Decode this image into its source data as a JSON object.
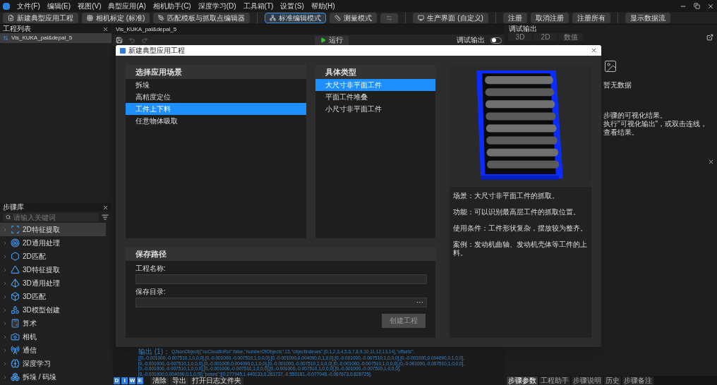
{
  "menu": [
    "文件(F)",
    "编辑(E)",
    "视图(V)",
    "典型应用(A)",
    "相机助手(C)",
    "深度学习(D)",
    "工具箱(T)",
    "设置(S)",
    "帮助(H)"
  ],
  "toolbar_groups": [
    [
      {
        "kind": "new",
        "label": "新建典型应用工程"
      },
      {
        "kind": "calib",
        "label": "相机标定 (标准)"
      },
      {
        "kind": "match",
        "label": "匹配模板与抓取点编辑器"
      }
    ],
    [
      {
        "kind": "mode",
        "label": "标准编辑模式",
        "selected": true
      },
      {
        "kind": "measure",
        "label": "测量模式",
        "selected": false
      },
      {
        "kind": "nav"
      }
    ],
    [
      {
        "kind": "production",
        "label": "生产界面 (自定义)"
      }
    ],
    [
      {
        "kind": "plain",
        "label": "注册"
      },
      {
        "kind": "plain",
        "label": "取消注册"
      },
      {
        "kind": "plain",
        "label": "注册所有"
      }
    ],
    [
      {
        "kind": "plain",
        "label": "显示数据流"
      }
    ]
  ],
  "project_list": {
    "title": "工程列表",
    "items": [
      {
        "label": "Vis_KUKA_pal&depal_5",
        "selected": true
      }
    ]
  },
  "step_library": {
    "title": "步骤库",
    "search_placeholder": "请输入关键词",
    "items": [
      {
        "kind": "scan",
        "label": "2D特征提取",
        "selected": true,
        "expanded": false
      },
      {
        "kind": "target",
        "label": "2D通用处理",
        "selected": false,
        "expanded": false
      },
      {
        "kind": "hexagon",
        "label": "2D匹配",
        "selected": false,
        "expanded": false
      },
      {
        "kind": "triangle",
        "label": "3D特征提取",
        "selected": false,
        "expanded": false
      },
      {
        "kind": "pyramid",
        "label": "3D通用处理",
        "selected": false,
        "expanded": false
      },
      {
        "kind": "box",
        "label": "3D匹配",
        "selected": false,
        "expanded": false
      },
      {
        "kind": "shapes",
        "label": "3D模型创建",
        "selected": false,
        "expanded": false
      },
      {
        "kind": "calculator",
        "label": "算术",
        "selected": false,
        "expanded": false
      },
      {
        "kind": "camera",
        "label": "相机",
        "selected": false,
        "expanded": false
      },
      {
        "kind": "tower",
        "label": "通信",
        "selected": false,
        "expanded": false
      },
      {
        "kind": "brain",
        "label": "深度学习",
        "selected": false,
        "expanded": false
      },
      {
        "kind": "boxes",
        "label": "拆垛 / 码垛",
        "selected": false,
        "expanded": false
      }
    ]
  },
  "editor": {
    "tab": "Vis_KUKA_pal&depal_5",
    "run": "运行",
    "debug_label": "调试输出",
    "debug_on": false
  },
  "log": {
    "prefix": "输出 (1)：",
    "lines": [
      "QJsonObject({\"noCloudInRoi\":false,\"numberOfObjects\":15,\"objectIndexes\":[0,1,2,3,4,5,6,7,8,9,10,11,12,13,14],\"offsets\":",
      "[[0,-0.001000,-0.007510,1,0,0,0],[0,-0.001000,-0.007510,1,0,0,0],[0,-0.001000,0.004090,0,1,0,0],[0,-0.001000,-0.007510,1,0,0,0],[0,-0.001000,0.004090,0,1,0,0],",
      "[0,-0.001000,-0.007510,1,0,0,0],[0,-0.001000,0.004090,0,1,0,0],[0,-0.001000,-0.007510,1,0,0,0],[0,-0.001000,-0.007510,1,0,0,0],[0,-0.001000,-0.007510,1,0,0,0],",
      "[0,-0.001000,-0.007510,1,0,0,0],[0,-0.001000,-0.007510,1,0,0,0],[0,-0.001000,-0.007510,1,0,0,0],[0,-0.001000,-0.007510,1,0,0,0],",
      "[0,-0.001000,0.004090,0,1,0,0]],\"poses\":[[0.277945,1.440133,0.261737,-0.550181,-0.077046,-0.067673,0.828725],"
    ],
    "levels": [
      {
        "label": "D",
        "on": true
      },
      {
        "label": "i",
        "on": true
      },
      {
        "label": "W",
        "on": true
      },
      {
        "label": "E",
        "on": true
      }
    ],
    "actions": [
      "清除",
      "导出",
      "打开日志文件夹"
    ]
  },
  "debug_output": {
    "title": "调试输出",
    "tabs": [
      {
        "label": "3D",
        "selected": false
      },
      {
        "label": "2D",
        "selected": false
      },
      {
        "label": "数值",
        "selected": false
      }
    ],
    "empty": "暂无数据",
    "hints": [
      "步骤的可视化结果。",
      "执行\"可视化输出\"，或双击连线，查看结果。"
    ]
  },
  "bottom_tabs": [
    {
      "label": "步骤参数",
      "selected": true
    },
    {
      "label": "工程助手",
      "selected": false
    },
    {
      "label": "步骤说明",
      "selected": false
    },
    {
      "label": "历史",
      "selected": false
    },
    {
      "label": "步骤备注",
      "selected": false
    }
  ],
  "dialog": {
    "title": "新建典型应用工程",
    "scenario": {
      "title": "选择应用场景",
      "items": [
        {
          "label": "拆垛",
          "selected": false
        },
        {
          "label": "高精度定位",
          "selected": false
        },
        {
          "label": "工件上下料",
          "selected": true
        },
        {
          "label": "任意物体吸取",
          "selected": false
        }
      ]
    },
    "type": {
      "title": "具体类型",
      "items": [
        {
          "label": "大尺寸非平面工件",
          "selected": true
        },
        {
          "label": "平面工件堆叠",
          "selected": false
        },
        {
          "label": "小尺寸非平面工件",
          "selected": false
        }
      ]
    },
    "preview": {
      "kind": "picture"
    },
    "description": [
      "场景：大尺寸非平面工件的抓取。",
      "功能：可以识别最高层工件的抓取位置。",
      "使用条件：工件形状复杂，摆放较为整齐。",
      "案例：发动机曲轴、发动机壳体等工件的上料。"
    ],
    "save": {
      "title": "保存路径",
      "name_label": "工程名称:",
      "dir_label": "保存目录:",
      "browse": "···",
      "create": "创建工程",
      "create_disabled": true
    }
  }
}
